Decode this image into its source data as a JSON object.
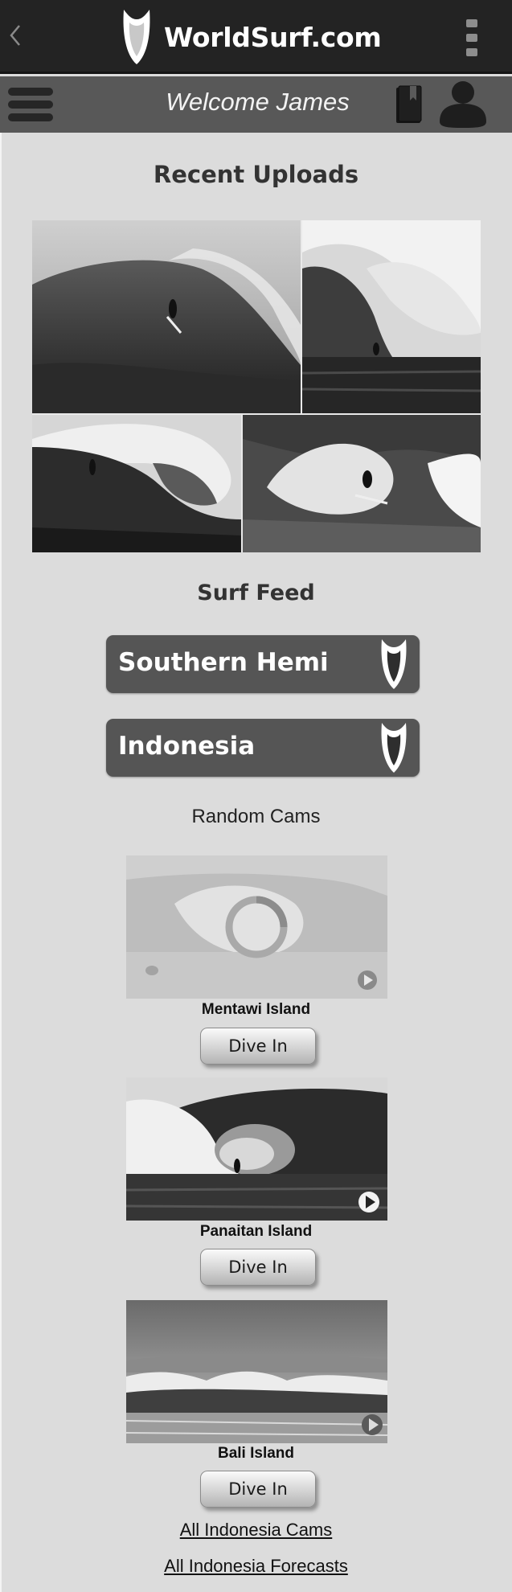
{
  "header": {
    "brand": "WorldSurf.com",
    "welcome": "Welcome James",
    "back_icon": "chevron-left-icon",
    "logo_icon": "surfboard-logo-icon",
    "overflow_icon": "kebab-menu-icon",
    "menu_icon": "hamburger-menu-icon",
    "bookmark_icon": "bookmark-icon",
    "profile_icon": "user-profile-icon"
  },
  "uploads": {
    "title": "Recent Uploads"
  },
  "feed": {
    "title": "Surf Feed",
    "items": [
      {
        "label": "Southern Hemi",
        "icon": "surfboard-logo-icon"
      },
      {
        "label": "Indonesia",
        "icon": "surfboard-logo-icon"
      }
    ]
  },
  "cams": {
    "title": "Random Cams",
    "items": [
      {
        "name": "Mentawi Island",
        "button": "Dive In",
        "state": "loading"
      },
      {
        "name": "Panaitan Island",
        "button": "Dive In",
        "state": "ready"
      },
      {
        "name": "Bali Island",
        "button": "Dive In",
        "state": "ready"
      }
    ]
  },
  "links": {
    "all_cams": "All Indonesia Cams",
    "all_forecasts": "All Indonesia Forecasts"
  },
  "colors": {
    "topbar": "#232323",
    "welcome_bar": "#585858",
    "background": "#dcdcdc",
    "feed_button": "#555555"
  }
}
